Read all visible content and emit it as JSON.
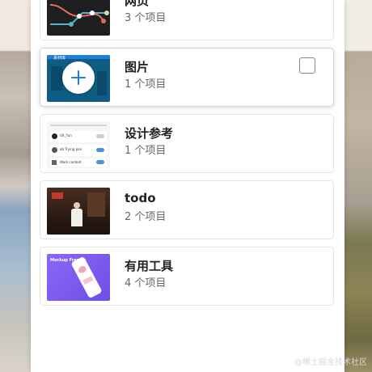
{
  "folders": [
    {
      "title": "网页",
      "count": "3 个项目"
    },
    {
      "title": "图片",
      "count": "1 个项目"
    },
    {
      "title": "设计参考",
      "count": "1 个项目"
    },
    {
      "title": "todo",
      "count": "2 个项目"
    },
    {
      "title": "有用工具",
      "count": "4 个项目"
    }
  ],
  "thumbnails": {
    "image_tag": "素材库",
    "design_rows": [
      "UX_Yun",
      "ab Trying pan",
      "Work content"
    ],
    "tools_caption": "Mockup Frames"
  },
  "watermark": "@稀土掘金技术社区",
  "colors": {
    "accent": "#1d7fd6",
    "tools_purple": "#7b5cf0"
  },
  "icons": {
    "add": "plus-icon",
    "select": "checkbox-icon"
  }
}
